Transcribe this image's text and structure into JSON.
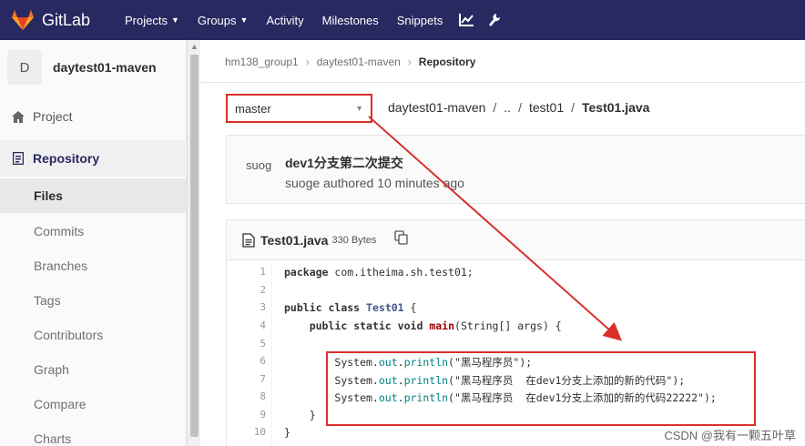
{
  "navbar": {
    "brand": "GitLab",
    "items": [
      {
        "label": "Projects",
        "caret": true
      },
      {
        "label": "Groups",
        "caret": true
      },
      {
        "label": "Activity",
        "caret": false
      },
      {
        "label": "Milestones",
        "caret": false
      },
      {
        "label": "Snippets",
        "caret": false
      }
    ],
    "icons": [
      "chart-icon",
      "wrench-icon"
    ]
  },
  "sidebar": {
    "avatar_letter": "D",
    "project_name": "daytest01-maven",
    "project_label": "Project",
    "repository_label": "Repository",
    "sub_items": [
      "Files",
      "Commits",
      "Branches",
      "Tags",
      "Contributors",
      "Graph",
      "Compare",
      "Charts"
    ]
  },
  "breadcrumbs": [
    "hm138_group1",
    "daytest01-maven",
    "Repository"
  ],
  "branch": {
    "selected": "master"
  },
  "path": {
    "root": "daytest01-maven",
    "up": "..",
    "dir": "test01",
    "file": "Test01.java"
  },
  "commit": {
    "avatar_text": "suoge",
    "title": "dev1分支第二次提交",
    "meta": "suoge authored 10 minutes ago"
  },
  "file": {
    "name": "Test01.java",
    "size": "330 Bytes"
  },
  "code": {
    "line_numbers": [
      "1",
      "2",
      "3",
      "4",
      "5",
      "6",
      "7",
      "8",
      "9",
      "10"
    ],
    "l1_kw": "package",
    "l1_pkg": "com.itheima.sh.test01;",
    "l3_kw1": "public",
    "l3_kw2": "class",
    "l3_cls": "Test01",
    "l3_rest": "{",
    "l4_kw1": "public",
    "l4_kw2": "static",
    "l4_kw3": "void",
    "l4_fn": "main",
    "l4_rest": "(String[] args) {",
    "l6_pre": "System.",
    "l6_out": "out",
    "l6_dot": ".",
    "l6_fn": "println",
    "l6_str": "(\"黑马程序员\");",
    "l7_pre": "System.",
    "l7_out": "out",
    "l7_dot": ".",
    "l7_fn": "println",
    "l7_str": "(\"黑马程序员  在dev1分支上添加的新的代码\");",
    "l8_pre": "System.",
    "l8_out": "out",
    "l8_dot": ".",
    "l8_fn": "println",
    "l8_str": "(\"黑马程序员  在dev1分支上添加的新的代码22222\");",
    "l9": "}",
    "l10": "}"
  },
  "annotation": {
    "color": "#d9302b"
  },
  "watermark": "CSDN @我有一颗五叶草",
  "colors": {
    "navbar": "#292961",
    "accent": "#d9302b"
  }
}
